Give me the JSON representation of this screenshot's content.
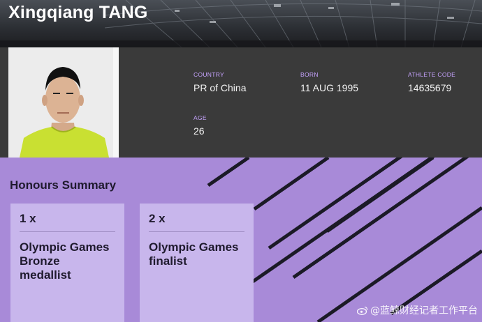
{
  "athlete": {
    "name": "Xingqiang TANG"
  },
  "profile": {
    "country_label": "COUNTRY",
    "country": "PR of China",
    "born_label": "BORN",
    "born": "11 AUG 1995",
    "code_label": "ATHLETE CODE",
    "code": "14635679",
    "age_label": "AGE",
    "age": "26"
  },
  "honours": {
    "title": "Honours Summary",
    "cards": [
      {
        "count": "1 x",
        "desc": "Olympic Games Bronze medallist"
      },
      {
        "count": "2 x",
        "desc": "Olympic Games finalist"
      }
    ]
  },
  "watermark": {
    "text": "@蓝鲸财经记者工作平台"
  },
  "colors": {
    "accent_label": "#c7a4ff",
    "honours_bg": "#a88ad8",
    "card_bg": "#c8b6ec",
    "panel_bg": "#3a3a3a"
  }
}
